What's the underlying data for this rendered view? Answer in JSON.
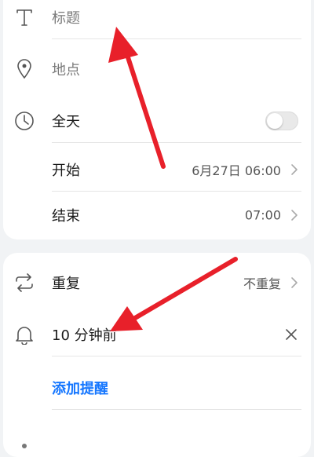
{
  "event_form": {
    "title_field": {
      "placeholder": "标题",
      "icon": "text-title-icon"
    },
    "location_field": {
      "placeholder": "地点",
      "icon": "location-pin-icon"
    },
    "all_day": {
      "label": "全天",
      "icon": "clock-icon",
      "enabled": false
    },
    "start": {
      "label": "开始",
      "value": "6月27日 06:00"
    },
    "end": {
      "label": "结束",
      "value": "07:00"
    }
  },
  "reminder_section": {
    "repeat": {
      "label": "重复",
      "value": "不重复",
      "icon": "repeat-icon"
    },
    "reminder": {
      "label": "10 分钟前",
      "icon": "bell-icon"
    },
    "add_reminder_label": "添加提醒"
  },
  "colors": {
    "accent": "#1677ff",
    "annotation_arrow": "#e8202a",
    "card_bg": "#ffffff",
    "page_bg": "#f1f3f5"
  }
}
